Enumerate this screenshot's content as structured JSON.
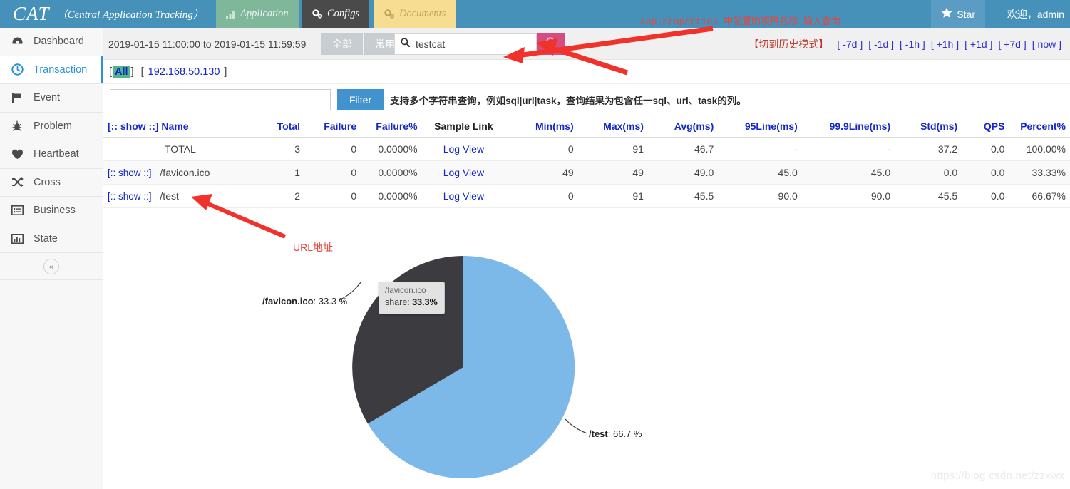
{
  "header": {
    "brand_short": "CAT",
    "brand_full": "（Central Application Tracking）",
    "tabs": [
      {
        "label": "Application",
        "icon": "bar-chart-icon"
      },
      {
        "label": "Configs",
        "icon": "gears-icon"
      },
      {
        "label": "Documents",
        "icon": "gears-icon"
      }
    ],
    "star_label": "Star",
    "star_icon": "star-icon",
    "welcome": "欢迎，admin"
  },
  "sidebar": {
    "items": [
      {
        "label": "Dashboard",
        "icon": "dashboard-icon"
      },
      {
        "label": "Transaction",
        "icon": "clock-icon"
      },
      {
        "label": "Event",
        "icon": "flag-icon"
      },
      {
        "label": "Problem",
        "icon": "bug-icon"
      },
      {
        "label": "Heartbeat",
        "icon": "heart-icon"
      },
      {
        "label": "Cross",
        "icon": "shuffle-icon"
      },
      {
        "label": "Business",
        "icon": "list-icon"
      },
      {
        "label": "State",
        "icon": "chart-icon"
      }
    ],
    "active_index": 1,
    "collapse_icon": "double-chevron-left-icon"
  },
  "toolbar": {
    "date_range": "2019-01-15 11:00:00 to 2019-01-15 11:59:59",
    "seg_all": "全部",
    "seg_common": "常用",
    "search_value": "testcat",
    "search_placeholder": "",
    "search_icon": "search-icon",
    "go_icon": "search-icon",
    "go_color": "#d34d80",
    "history_mode": "【切到历史模式】",
    "ranges": [
      "-7d",
      "-1d",
      "-1h",
      "+1h",
      "+1d",
      "+7d",
      "now"
    ]
  },
  "hostrow": {
    "open": "[",
    "close": "]",
    "all_label": "All",
    "ip_label": "192.168.50.130",
    "all_highlight_color": "#52b788"
  },
  "filterrow": {
    "input_value": "",
    "input_placeholder": "",
    "button_label": "Filter",
    "hint": "支持多个字符串查询，例如sql|url|task，查询结果为包含任一sql、url、task的列。"
  },
  "table": {
    "columns": [
      {
        "label": "[:: show ::] Name",
        "align": "left",
        "dark": false
      },
      {
        "label": "Total",
        "align": "right",
        "dark": false
      },
      {
        "label": "Failure",
        "align": "right",
        "dark": false
      },
      {
        "label": "Failure%",
        "align": "right",
        "dark": false
      },
      {
        "label": "Sample Link",
        "align": "center",
        "dark": true
      },
      {
        "label": "Min(ms)",
        "align": "right",
        "dark": false
      },
      {
        "label": "Max(ms)",
        "align": "right",
        "dark": false
      },
      {
        "label": "Avg(ms)",
        "align": "right",
        "dark": false
      },
      {
        "label": "95Line(ms)",
        "align": "right",
        "dark": false
      },
      {
        "label": "99.9Line(ms)",
        "align": "right",
        "dark": false
      },
      {
        "label": "Std(ms)",
        "align": "right",
        "dark": false
      },
      {
        "label": "QPS",
        "align": "right",
        "dark": false
      },
      {
        "label": "Percent%",
        "align": "right",
        "dark": false
      }
    ],
    "show_link_label": "[:: show ::]",
    "sample_link_label": "Log View",
    "rows": [
      {
        "show": "",
        "name": "TOTAL",
        "total": "3",
        "failure": "0",
        "failure_pct": "0.0000%",
        "sample": "Log View",
        "min": "0",
        "max": "91",
        "avg": "46.7",
        "line95": "-",
        "line999": "-",
        "std": "37.2",
        "qps": "0.0",
        "percent": "100.00%"
      },
      {
        "show": "[:: show ::]",
        "name": "/favicon.ico",
        "total": "1",
        "failure": "0",
        "failure_pct": "0.0000%",
        "sample": "Log View",
        "min": "49",
        "max": "49",
        "avg": "49.0",
        "line95": "45.0",
        "line999": "45.0",
        "std": "0.0",
        "qps": "0.0",
        "percent": "33.33%"
      },
      {
        "show": "[:: show ::]",
        "name": "/test",
        "total": "2",
        "failure": "0",
        "failure_pct": "0.0000%",
        "sample": "Log View",
        "min": "0",
        "max": "91",
        "avg": "45.5",
        "line95": "90.0",
        "line999": "90.0",
        "std": "45.5",
        "qps": "0.0",
        "percent": "66.67%"
      }
    ]
  },
  "chart_data": {
    "type": "pie",
    "title": "",
    "legend_position": "labels",
    "categories": [
      "/test",
      "/favicon.ico"
    ],
    "values": [
      66.7,
      33.3
    ],
    "colors": [
      "#7cb9e8",
      "#3b3b40"
    ],
    "labels": [
      {
        "name": "/test",
        "value": "66.7 %"
      },
      {
        "name": "/favicon.ico",
        "value": "33.3 %"
      }
    ],
    "tooltip": {
      "name": "/favicon.ico",
      "metric_label": "share:",
      "metric_value": "33.3%"
    }
  },
  "annotations": [
    {
      "id": "anno1",
      "text": "app.properties 中配置的项目名称 输入查询"
    },
    {
      "id": "anno2",
      "text": "URL地址"
    }
  ],
  "watermark": "https://blog.csdn.net/zzxwx"
}
